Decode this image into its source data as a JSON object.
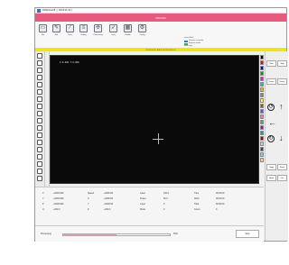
{
  "window": {
    "title": "RDWorksV8 - [ RD-8.01.53 ]"
  },
  "banner": {
    "title": "RDCAM"
  },
  "toolbar": {
    "items": [
      {
        "label": "File",
        "icon": "folder-icon"
      },
      {
        "label": "Edit",
        "icon": "edit-icon"
      },
      {
        "label": "Draw",
        "icon": "draw-icon"
      },
      {
        "label": "Setting",
        "icon": "setting-icon"
      },
      {
        "label": "Processing",
        "icon": "processing-icon"
      },
      {
        "label": "Laser",
        "icon": "laser-icon"
      },
      {
        "label": "Handle",
        "icon": "handle-icon"
      },
      {
        "label": "Config",
        "icon": "gear-icon"
      }
    ],
    "info_lines": [
      "Laser Work",
      "Process cut mode",
      "Engrave mode",
      "Auto-layer"
    ]
  },
  "stripe": {
    "text": "RDWORKS LASER WORKSTATION"
  },
  "canvas": {
    "coord": "X:0.000 Y:0.000"
  },
  "palette": [
    "#000000",
    "#ff0000",
    "#0000ff",
    "#00aa00",
    "#ff00ff",
    "#00cccc",
    "#ffaa00",
    "#888888",
    "#ffff00",
    "#aa5500",
    "#5555ff",
    "#ff77aa",
    "#55aa55",
    "#aa00aa",
    "#00aaaa",
    "#aa0000",
    "#cccccc",
    "#444444",
    "#77ccff",
    "#ffcc77"
  ],
  "right_panel": {
    "btn_a": "Start",
    "btn_b": "Stop",
    "btn_c": "Pause",
    "btn_d": "Frame",
    "btn_e": "Origin",
    "btn_f": "Reset",
    "btn_g": "Home",
    "btn_h": "Go"
  },
  "status": {
    "col_axis": [
      "X",
      "Y",
      "Z",
      "U"
    ],
    "col_pos": [
      "+0000.000",
      "+0000.000",
      "+0000.000",
      "+000.0"
    ],
    "col_label2": [
      "Speed",
      "X",
      "Y",
      "Z"
    ],
    "col_val2": [
      "+0000.00",
      "+0000.00",
      "+0000.00",
      "+000.0"
    ],
    "col_label3": [
      "Laser",
      "Power",
      "Layer",
      "Mode"
    ],
    "col_val3": [
      "100.0",
      "50.0",
      "0",
      "0"
    ],
    "col_label4": [
      "Time",
      "Work",
      "Total",
      "Count"
    ],
    "col_val4": [
      "00:00:00",
      "00:00:00",
      "00:00:00",
      "0"
    ]
  },
  "progress": {
    "label": "Processing",
    "percent": 50,
    "value": "50%",
    "button": "Stop"
  }
}
